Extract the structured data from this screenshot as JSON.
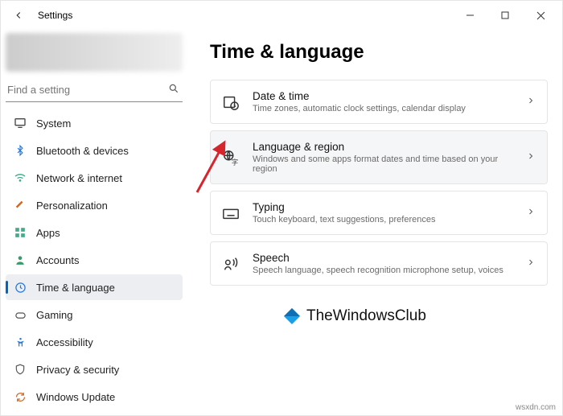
{
  "window": {
    "title": "Settings"
  },
  "search": {
    "placeholder": "Find a setting"
  },
  "nav": {
    "items": [
      {
        "label": "System"
      },
      {
        "label": "Bluetooth & devices"
      },
      {
        "label": "Network & internet"
      },
      {
        "label": "Personalization"
      },
      {
        "label": "Apps"
      },
      {
        "label": "Accounts"
      },
      {
        "label": "Time & language"
      },
      {
        "label": "Gaming"
      },
      {
        "label": "Accessibility"
      },
      {
        "label": "Privacy & security"
      },
      {
        "label": "Windows Update"
      }
    ],
    "active_index": 6
  },
  "page": {
    "title": "Time & language"
  },
  "cards": [
    {
      "title": "Date & time",
      "sub": "Time zones, automatic clock settings, calendar display"
    },
    {
      "title": "Language & region",
      "sub": "Windows and some apps format dates and time based on your region"
    },
    {
      "title": "Typing",
      "sub": "Touch keyboard, text suggestions, preferences"
    },
    {
      "title": "Speech",
      "sub": "Speech language, speech recognition microphone setup, voices"
    }
  ],
  "watermark": {
    "brand": "TheWindowsClub",
    "footer": "wsxdn.com"
  }
}
